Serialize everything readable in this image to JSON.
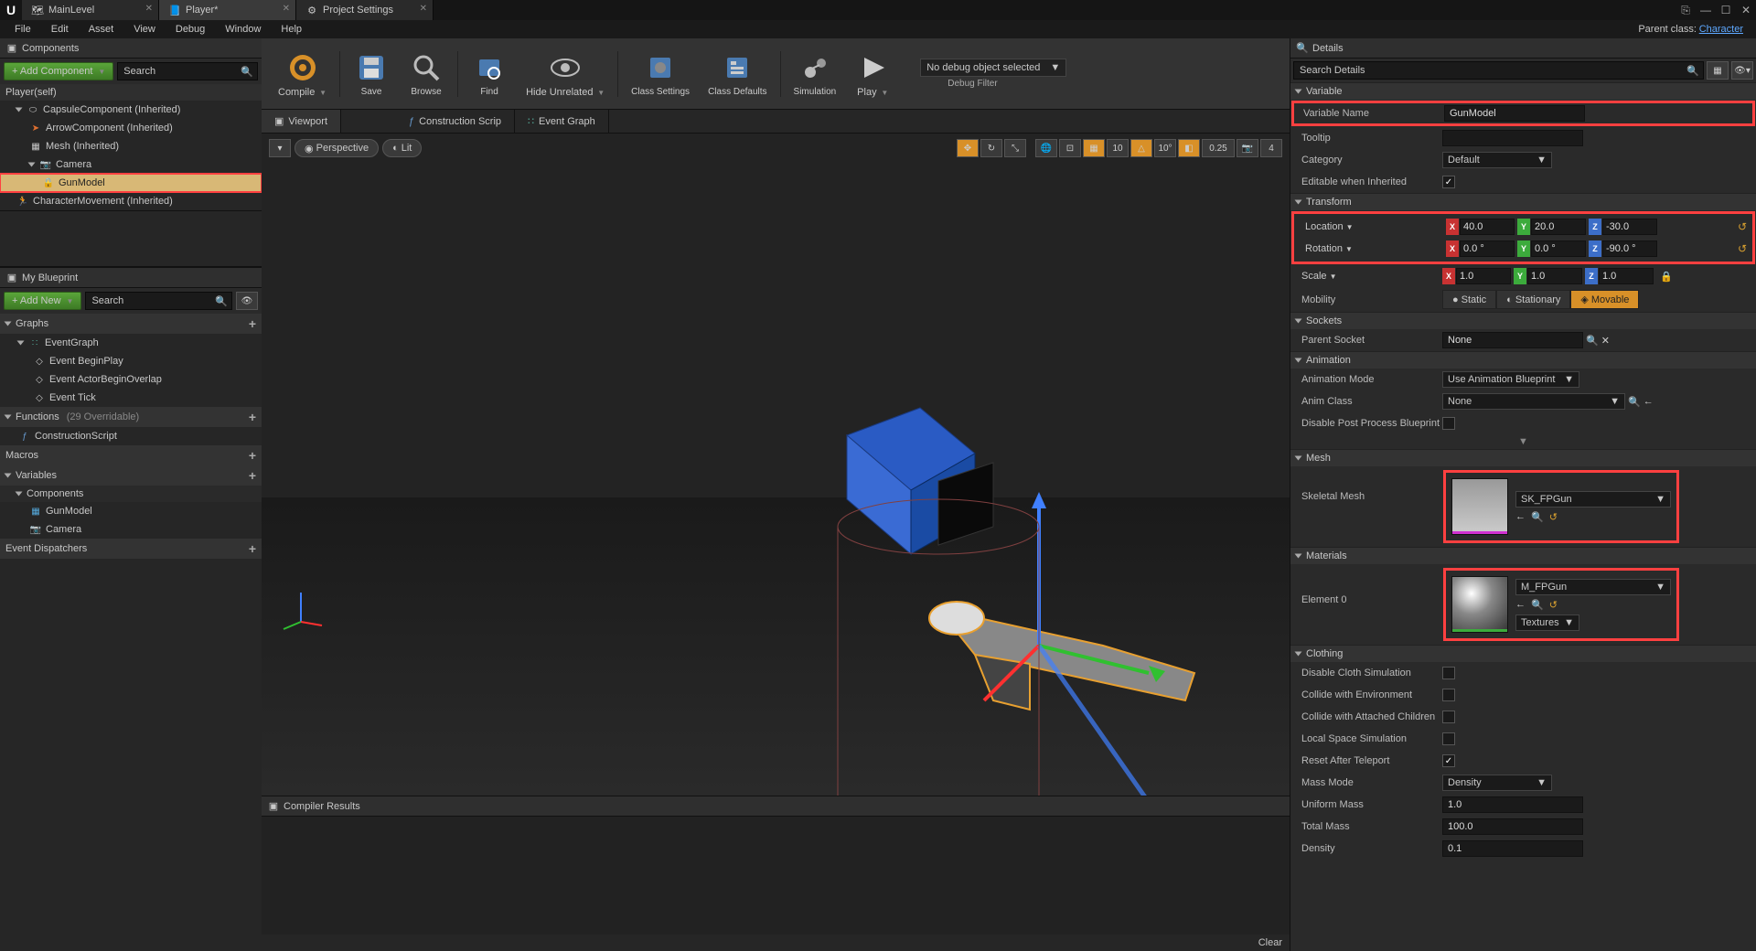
{
  "tabs": [
    {
      "label": "MainLevel",
      "icon": "level"
    },
    {
      "label": "Player*",
      "icon": "bp",
      "active": true
    },
    {
      "label": "Project Settings",
      "icon": "gear"
    }
  ],
  "parent_class_label": "Parent class:",
  "parent_class_value": "Character",
  "menu": [
    "File",
    "Edit",
    "Asset",
    "View",
    "Debug",
    "Window",
    "Help"
  ],
  "components_panel": {
    "title": "Components",
    "add_btn": "+ Add Component",
    "search": "Search",
    "items": [
      {
        "label": "Player(self)",
        "indent": 0
      },
      {
        "label": "CapsuleComponent (Inherited)",
        "indent": 1,
        "icon": "capsule",
        "expand": true
      },
      {
        "label": "ArrowComponent (Inherited)",
        "indent": 2,
        "icon": "arrow"
      },
      {
        "label": "Mesh (Inherited)",
        "indent": 2,
        "icon": "mesh"
      },
      {
        "label": "Camera",
        "indent": 2,
        "icon": "camera",
        "expand": true
      },
      {
        "label": "GunModel",
        "indent": 3,
        "icon": "mesh",
        "selected": true,
        "highlight": true
      },
      {
        "label": "CharacterMovement (Inherited)",
        "indent": 1,
        "icon": "move"
      }
    ]
  },
  "my_blueprint": {
    "title": "My Blueprint",
    "add_btn": "+ Add New",
    "search": "Search",
    "sections": [
      {
        "title": "Graphs",
        "items": [
          {
            "label": "EventGraph",
            "icon": "graph",
            "expand": true
          },
          {
            "label": "Event BeginPlay",
            "icon": "event",
            "indent": 1
          },
          {
            "label": "Event ActorBeginOverlap",
            "icon": "event",
            "indent": 1
          },
          {
            "label": "Event Tick",
            "icon": "event",
            "indent": 1
          }
        ]
      },
      {
        "title": "Functions",
        "suffix": "(29 Overridable)",
        "items": [
          {
            "label": "ConstructionScript",
            "icon": "func"
          }
        ]
      },
      {
        "title": "Macros",
        "items": []
      },
      {
        "title": "Variables",
        "items": []
      },
      {
        "title": "Components",
        "items": [
          {
            "label": "GunModel",
            "icon": "mesh"
          },
          {
            "label": "Camera",
            "icon": "camera"
          }
        ]
      },
      {
        "title": "Event Dispatchers",
        "items": []
      }
    ]
  },
  "toolbar": [
    {
      "label": "Compile",
      "icon": "compile"
    },
    {
      "label": "Save",
      "icon": "save"
    },
    {
      "label": "Browse",
      "icon": "browse"
    },
    {
      "label": "Find",
      "icon": "find"
    },
    {
      "label": "Hide Unrelated",
      "icon": "hide"
    },
    {
      "label": "Class Settings",
      "icon": "settings"
    },
    {
      "label": "Class Defaults",
      "icon": "defaults"
    },
    {
      "label": "Simulation",
      "icon": "sim"
    },
    {
      "label": "Play",
      "icon": "play"
    }
  ],
  "debug_filter": {
    "selected": "No debug object selected",
    "label": "Debug Filter"
  },
  "subtabs": [
    {
      "label": "Viewport",
      "icon": "vp",
      "active": true
    },
    {
      "label": "Construction Scrip",
      "icon": "func"
    },
    {
      "label": "Event Graph",
      "icon": "graph"
    }
  ],
  "viewport": {
    "perspective": "Perspective",
    "lit": "Lit",
    "snap_grid": "10",
    "snap_angle": "10°",
    "snap_scale": "0.25",
    "cam_speed": "4"
  },
  "compiler_results": {
    "title": "Compiler Results",
    "clear": "Clear"
  },
  "details": {
    "title": "Details",
    "search": "Search Details",
    "sections": {
      "variable": {
        "title": "Variable",
        "name_label": "Variable Name",
        "name_value": "GunModel",
        "name_highlight": true,
        "tooltip_label": "Tooltip",
        "tooltip_value": "",
        "category_label": "Category",
        "category_value": "Default",
        "editable_label": "Editable when Inherited",
        "editable_checked": true
      },
      "transform": {
        "title": "Transform",
        "location_label": "Location",
        "location": {
          "x": "40.0",
          "y": "20.0",
          "z": "-30.0"
        },
        "location_highlight": true,
        "rotation_label": "Rotation",
        "rotation": {
          "x": "0.0 °",
          "y": "0.0 °",
          "z": "-90.0 °"
        },
        "rotation_highlight": true,
        "scale_label": "Scale",
        "scale": {
          "x": "1.0",
          "y": "1.0",
          "z": "1.0"
        },
        "mobility_label": "Mobility",
        "mobility": [
          "Static",
          "Stationary",
          "Movable"
        ],
        "mobility_selected": "Movable"
      },
      "sockets": {
        "title": "Sockets",
        "parent_label": "Parent Socket",
        "parent_value": "None"
      },
      "animation": {
        "title": "Animation",
        "mode_label": "Animation Mode",
        "mode_value": "Use Animation Blueprint",
        "class_label": "Anim Class",
        "class_value": "None",
        "disable_pp_label": "Disable Post Process Blueprint"
      },
      "mesh": {
        "title": "Mesh",
        "label": "Skeletal Mesh",
        "value": "SK_FPGun",
        "highlight": true
      },
      "materials": {
        "title": "Materials",
        "label": "Element 0",
        "value": "M_FPGun",
        "textures_btn": "Textures",
        "highlight": true
      },
      "clothing": {
        "title": "Clothing",
        "rows": [
          {
            "label": "Disable Cloth Simulation",
            "checked": false
          },
          {
            "label": "Collide with Environment",
            "checked": false
          },
          {
            "label": "Collide with Attached Children",
            "checked": false
          },
          {
            "label": "Local Space Simulation",
            "checked": false
          },
          {
            "label": "Reset After Teleport",
            "checked": true
          }
        ],
        "mass_mode_label": "Mass Mode",
        "mass_mode_value": "Density",
        "uniform_mass_label": "Uniform Mass",
        "uniform_mass_value": "1.0",
        "total_mass_label": "Total Mass",
        "total_mass_value": "100.0",
        "density_label": "Density",
        "density_value": "0.1"
      }
    }
  }
}
